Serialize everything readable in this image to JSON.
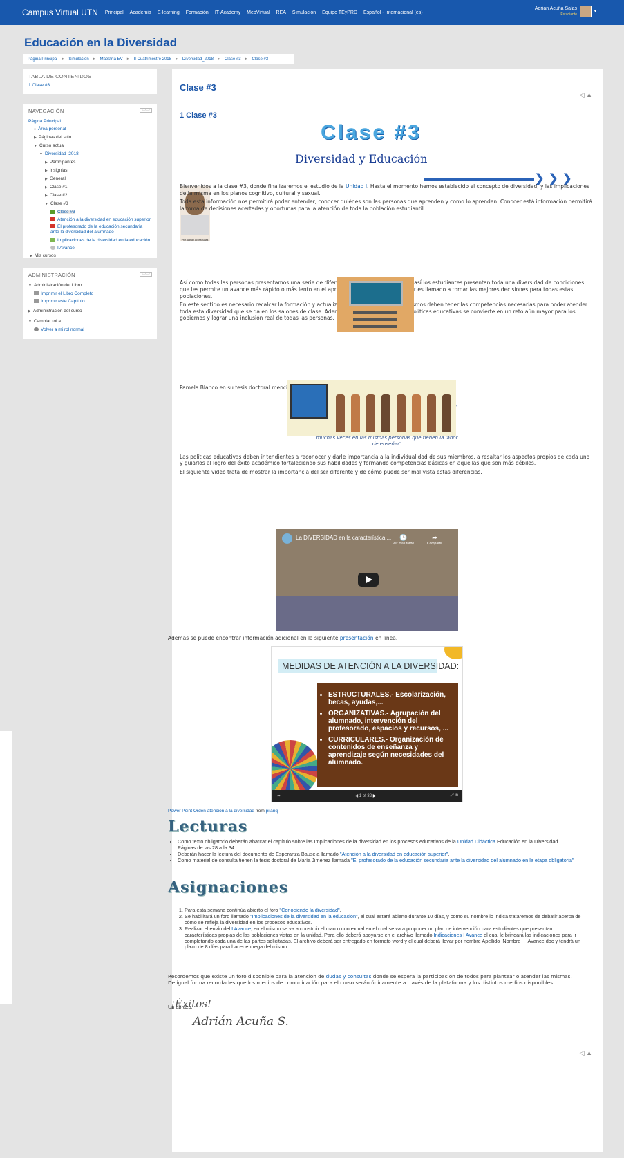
{
  "topbar": {
    "brand": "Campus Virtual UTN",
    "nav": [
      "Principal",
      "Academia",
      "E-learning",
      "Formación",
      "IT-Academy",
      "MepVirtual",
      "REA",
      "Simulación",
      "Equipo TEyPRD",
      "Español - Internacional (es)"
    ],
    "user_name": "Adrian Acuña Salas",
    "user_role": "Estudiante"
  },
  "page_title": "Educación en la Diversidad",
  "breadcrumb": [
    "Página Principal",
    "Simulacion",
    "Maestría EV",
    "II Cuatrimestre 2018",
    "Diversidad_2018",
    "Clase #3",
    "Clase #3"
  ],
  "toc": {
    "title": "TABLA DE CONTENIDOS",
    "item": "1 Clase #3"
  },
  "navigation": {
    "title": "NAVEGACIÓN",
    "home": "Página Principal",
    "personal": "Área personal",
    "site": "Páginas del sitio",
    "current": "Curso actual",
    "course": "Diversidad_2018",
    "participants": "Participantes",
    "badges": "Insignias",
    "general": "General",
    "c1": "Clase #1",
    "c2": "Clase #2",
    "c3": "Clase #3",
    "c3book": "Clase #3",
    "r1": "Atención a la diversidad en educación superior",
    "r2": "El profesorado de la educación secundaria ante la diversidad del alumnado",
    "r3": "Implicaciones de la diversidad en la educación",
    "r4": "I Avance",
    "mycourses": "Mis cursos"
  },
  "admin": {
    "title": "ADMINISTRACIÓN",
    "book": "Administración del Libro",
    "print_book": "Imprimir el Libro Completo",
    "print_chapter": "Imprimir este Capítulo",
    "course_admin": "Administración del curso",
    "role": "Cambiar rol a...",
    "back_role": "Volver a mi rol normal"
  },
  "content": {
    "title": "Clase #3",
    "chapter": "1 Clase #3",
    "banner_title": "Clase #3",
    "banner_subtitle": "Diversidad y Educación",
    "photo_caption": "Prof. Adrián Acuña Salas",
    "p1a": "Bienvenidos a la clase #3, donde finalizaremos el estudio de la ",
    "p1link": "Unidad I",
    "p1b": ". Hasta el momento hemos establecido el concepto de diversidad, y las implicaciones de la misma en los planos cognitivo, cultural y sexual.",
    "p2": "Toda esta información nos permitirá poder entender, conocer quiénes son las personas que aprenden y como lo aprenden. Conocer está información permitirá la toma de decisiones acertadas y oportunas para la atención de toda la población estudiantil.",
    "p3": "Así como todas las personas presentamos una serie de diferencias que nos hacen únicos, así los estudiantes presentan toda una diversidad de condiciones que les permite un avance más rápido o más lento en el aprendizaje. Por tanto, el profesor es llamado a tomar las mejores decisiones para todas estas poblaciones.",
    "p4": "En este sentido es necesario recalcar la formación y actualización de los docentes, los mismos deben tener las competencias necesarias para poder atender toda esta diversidad que se da en los salones de clase. Además, el mejoramiento de las políticas educativas se convierte en un reto aún mayor para los gobiernos y lograr una inclusión real de todas las personas.",
    "p5": "Pamela Blanco en su tesis doctoral menciona que:",
    "quote": "\"La inclusión de la diversidad en el aula, significa hacer efectivo para todos; el derecho a la educación de calidad, la igualdad de oportunidades y la participación. Además; significa eliminar las barreras que enfrentan muchos alumnos para acceder al aprendizaje y participar. Estas barreras están en la sociedad, en la escuela, en el aula y muchas veces en las mismas personas que tienen la labor de enseñar\"",
    "p6": "Las políticas educativas deben ir tendientes a reconocer y darle importancia a la individualidad de sus miembros, a resaltar los aspectos propios de cada uno y guiarlos al logro del éxito académico fortaleciendo sus habilidades y formando competencias básicas en aquellas que son más débiles.",
    "p7": "El siguiente video trata de mostrar la importancia del ser diferente y de cómo puede ser mal vista estas diferencias.",
    "video_title": "La DIVERSIDAD en la característica ...",
    "video_later": "Ver más tarde",
    "video_share": "Compartir",
    "p8a": "Además se puede encontrar información adicional en la siguiente ",
    "p8link": "presentación",
    "p8b": " en línea.",
    "slide_title": "MEDIDAS DE ATENCIÓN A LA DIVERSIDAD:",
    "slide_items": [
      "ESTRUCTURALES.- Escolarización, becas, ayudas,...",
      "ORGANIZATIVAS.- Agrupación del alumnado, intervención del profesorado, espacios y recursos, ...",
      "CURRICULARES.- Organización de contenidos de enseñanza y aprendizaje según necesidades del alumnado."
    ],
    "slide_page": "1 of 32",
    "ppt_a": "Power Point Orden atención a la diversidad",
    "ppt_b": " from ",
    "ppt_c": "pilariq",
    "lecturas": "Lecturas",
    "l1a": "Como texto obligatorio deberán abarcar el capítulo sobre las Implicaciones de la diversidad en los procesos educativos de la ",
    "l1link": "Unidad Didáctica",
    "l1b": " Educación en la Diversidad.  Páginas de las 28 a la 34.",
    "l2a": "Deberán hacer la lectura del documento de Esperanza Bausela llamado ",
    "l2link": "\"Atención a la diversidad en educación superior\"",
    "l2b": ".",
    "l3a": "Como material de consulta tienen la tesis doctoral de María Jiménez llamada ",
    "l3link": "\"El profesorado de la educación secundaria ante la diversidad del alumnado en la etapa obligatoria\"",
    "asignaciones": "Asignaciones",
    "a1a": "Para esta semana continúa abierto el foro ",
    "a1link": "\"Conociendo la diversidad\"",
    "a1b": ".",
    "a2a": "Se habilitará un foro llamado ",
    "a2link": "\"Implicaciones de la diversidad en la educación\"",
    "a2b": ", el cual estará abierto durante 10 días, y como su nombre lo indica trataremos de debatir acerca de cómo se refleja la diversidad en los procesos educativos.",
    "a3a": "Realizar el envío del ",
    "a3link": "I Avance",
    "a3b": ", en el mismo se va a construir el marco contextual en el cual se va a proponer un plan de intervención para estudiantes que presentan características propias de las poblaciones vistas en la unidad. Para ello deberá apoyarse en el archivo llamado ",
    "a3link2": "Indicaciones I Avance",
    "a3c": " el cual le brindará las indicaciones para ir completando cada una de las partes solicitadas. El archivo deberá ser entregado en formato word y el cual deberá llevar por nombre     Apellido_Nombre_I_Avance.doc y tendrá un plazo de 8 días para hacer entrega del mismo.",
    "p9a": "Recordemos que existe un foro disponible para la atención de ",
    "p9link": "dudas y consultas",
    "p9b": " donde se espera la participación de todos para plantear o atender las mismas. De igual forma recordarles que los medios de comunicación para el curso serán únicamente a través de la plataforma y los distintos medios disponibles.",
    "closing": "Un abrazo,",
    "sig1": "¡Éxitos!",
    "sig2": "Adrián Acuña S."
  },
  "icons": {
    "prev": "◁",
    "next": "▲"
  }
}
